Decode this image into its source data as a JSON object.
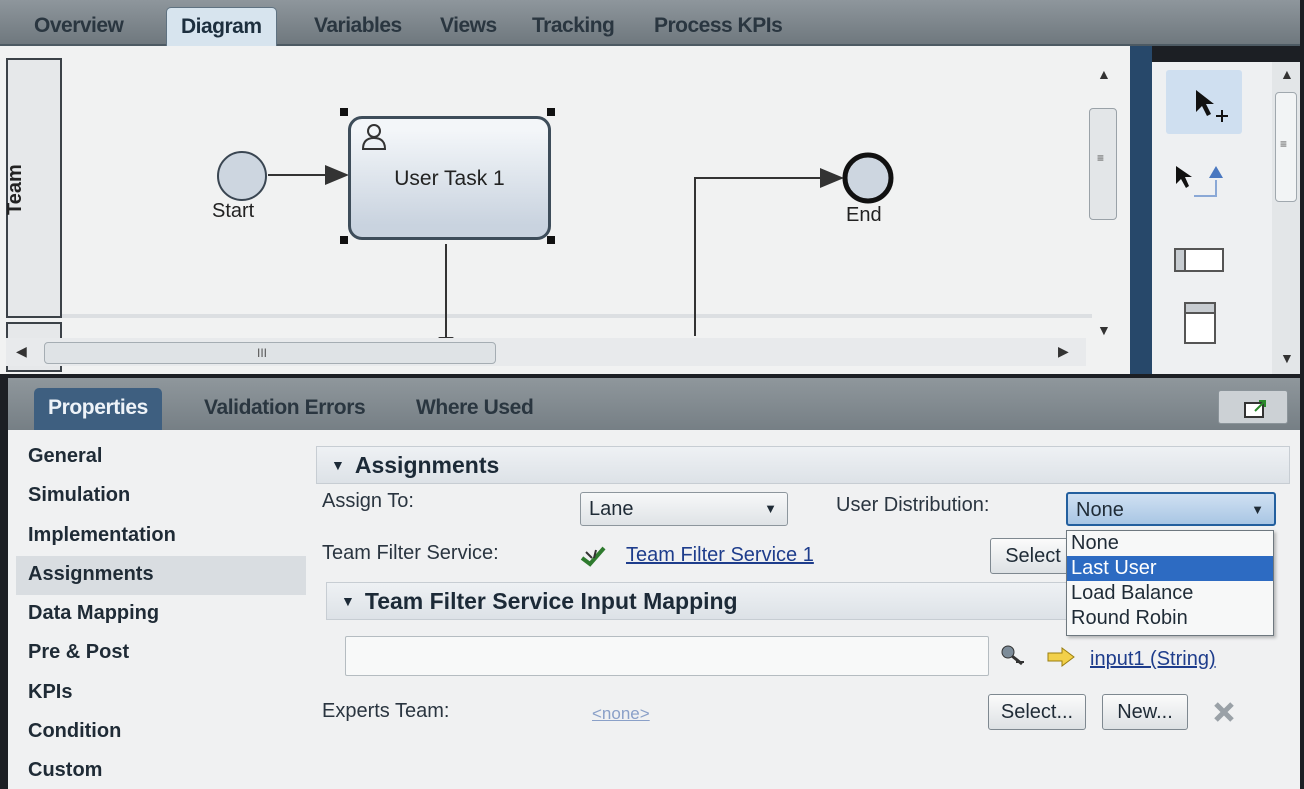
{
  "editor_tabs": [
    {
      "label": "Overview"
    },
    {
      "label": "Diagram"
    },
    {
      "label": "Variables"
    },
    {
      "label": "Views"
    },
    {
      "label": "Tracking"
    },
    {
      "label": "Process KPIs"
    }
  ],
  "diagram": {
    "lane": "Team",
    "start_label": "Start",
    "task_label": "User Task 1",
    "end_label": "End",
    "hscroll_grip": "III"
  },
  "properties": {
    "tabs": [
      {
        "label": "Properties"
      },
      {
        "label": "Validation Errors"
      },
      {
        "label": "Where Used"
      }
    ],
    "nav": [
      {
        "label": "General"
      },
      {
        "label": "Simulation"
      },
      {
        "label": "Implementation"
      },
      {
        "label": "Assignments"
      },
      {
        "label": "Data Mapping"
      },
      {
        "label": "Pre & Post"
      },
      {
        "label": "KPIs"
      },
      {
        "label": "Condition"
      },
      {
        "label": "Custom"
      }
    ],
    "assignments": {
      "header": "Assignments",
      "assign_to_label": "Assign To:",
      "assign_to_value": "Lane",
      "user_distribution_label": "User Distribution:",
      "user_distribution_value": "None",
      "user_distribution_options": [
        "None",
        "Last User",
        "Load Balance",
        "Round Robin"
      ],
      "highlighted_option": "Last User",
      "team_filter_label": "Team Filter Service:",
      "team_filter_link": "Team Filter Service 1",
      "select_label": "Select"
    },
    "input_mapping": {
      "header": "Team Filter Service Input Mapping",
      "input_link": "input1 (String)"
    },
    "experts": {
      "label": "Experts Team:",
      "value": "<none>",
      "select_label": "Select...",
      "new_label": "New..."
    }
  },
  "colors": {
    "selection_blue": "#2d6bc2",
    "active_tab": "#3e5f80",
    "link": "#1e3d8c"
  }
}
